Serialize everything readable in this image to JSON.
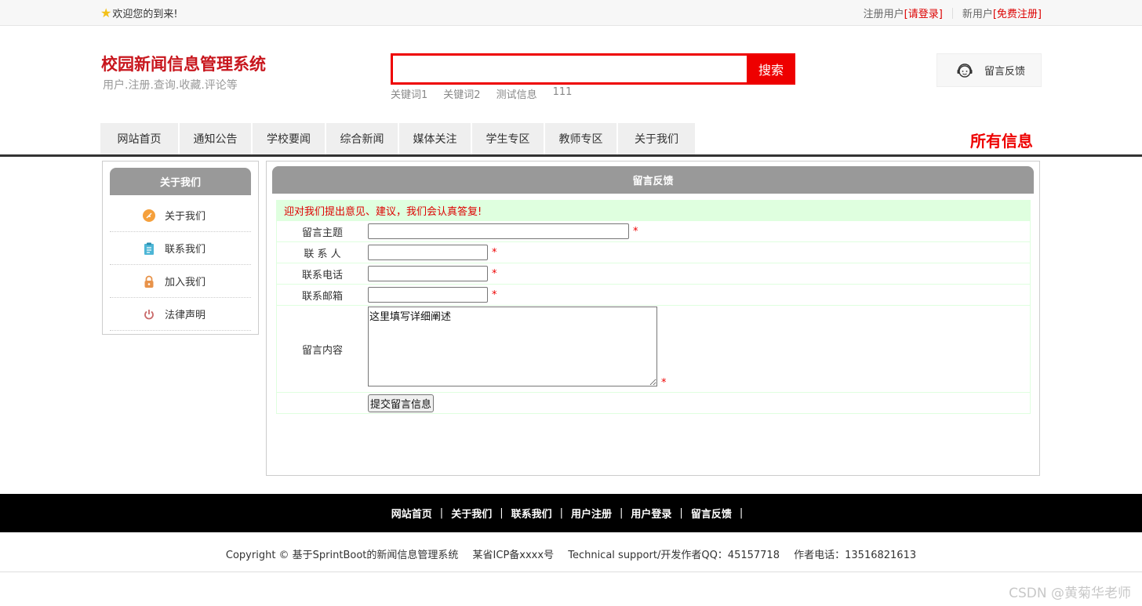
{
  "topbar": {
    "welcome": "欢迎您的到来!",
    "registered_label": "注册用户",
    "login_link": "[请登录]",
    "new_user_label": "新用户",
    "register_link": "[免费注册]"
  },
  "header": {
    "title": "校园新闻信息管理系统",
    "subtitle": "用户.注册.查询.收藏.评论等",
    "search_button": "搜索",
    "search_value": "",
    "keywords": [
      "关键词1",
      "关键词2",
      "测试信息",
      "111"
    ],
    "feedback_button": "留言反馈"
  },
  "nav": {
    "items": [
      {
        "label": "网站首页"
      },
      {
        "label": "通知公告"
      },
      {
        "label": "学校要闻"
      },
      {
        "label": "综合新闻"
      },
      {
        "label": "媒体关注"
      },
      {
        "label": "学生专区"
      },
      {
        "label": "教师专区"
      },
      {
        "label": "关于我们"
      }
    ],
    "all_info": "所有信息"
  },
  "sidebar": {
    "title": "关于我们",
    "items": [
      {
        "label": "关于我们",
        "icon": "feather-icon",
        "color": "#f5a03c"
      },
      {
        "label": "联系我们",
        "icon": "clipboard-icon",
        "color": "#4db6d6"
      },
      {
        "label": "加入我们",
        "icon": "lock-icon",
        "color": "#e8934a"
      },
      {
        "label": "法律声明",
        "icon": "power-icon",
        "color": "#c96a6a"
      }
    ]
  },
  "main": {
    "title": "留言反馈",
    "notice": "迎对我们提出意见、建议，我们会认真答复!",
    "fields": {
      "subject_label": "留言主题",
      "contact_label": "联 系 人",
      "phone_label": "联系电话",
      "email_label": "联系邮箱",
      "content_label": "留言内容",
      "content_value": "这里填写详细阐述",
      "required_mark": "*"
    },
    "submit_label": "提交留言信息"
  },
  "footer": {
    "links": [
      "网站首页",
      "关于我们",
      "联系我们",
      "用户注册",
      "用户登录",
      "留言反馈"
    ],
    "separator": "|",
    "copyright": "Copyright © 基于SprintBoot的新闻信息管理系统",
    "icp": "某省ICP备xxxx号",
    "support": "Technical support/开发作者QQ：45157718",
    "phone": "作者电话：13516821613"
  },
  "watermark": "CSDN @黄菊华老师",
  "colors": {
    "brand_red": "#c8161d",
    "accent_red": "#ee0000",
    "panel_gray": "#999999",
    "notice_green": "#dfffdf"
  }
}
